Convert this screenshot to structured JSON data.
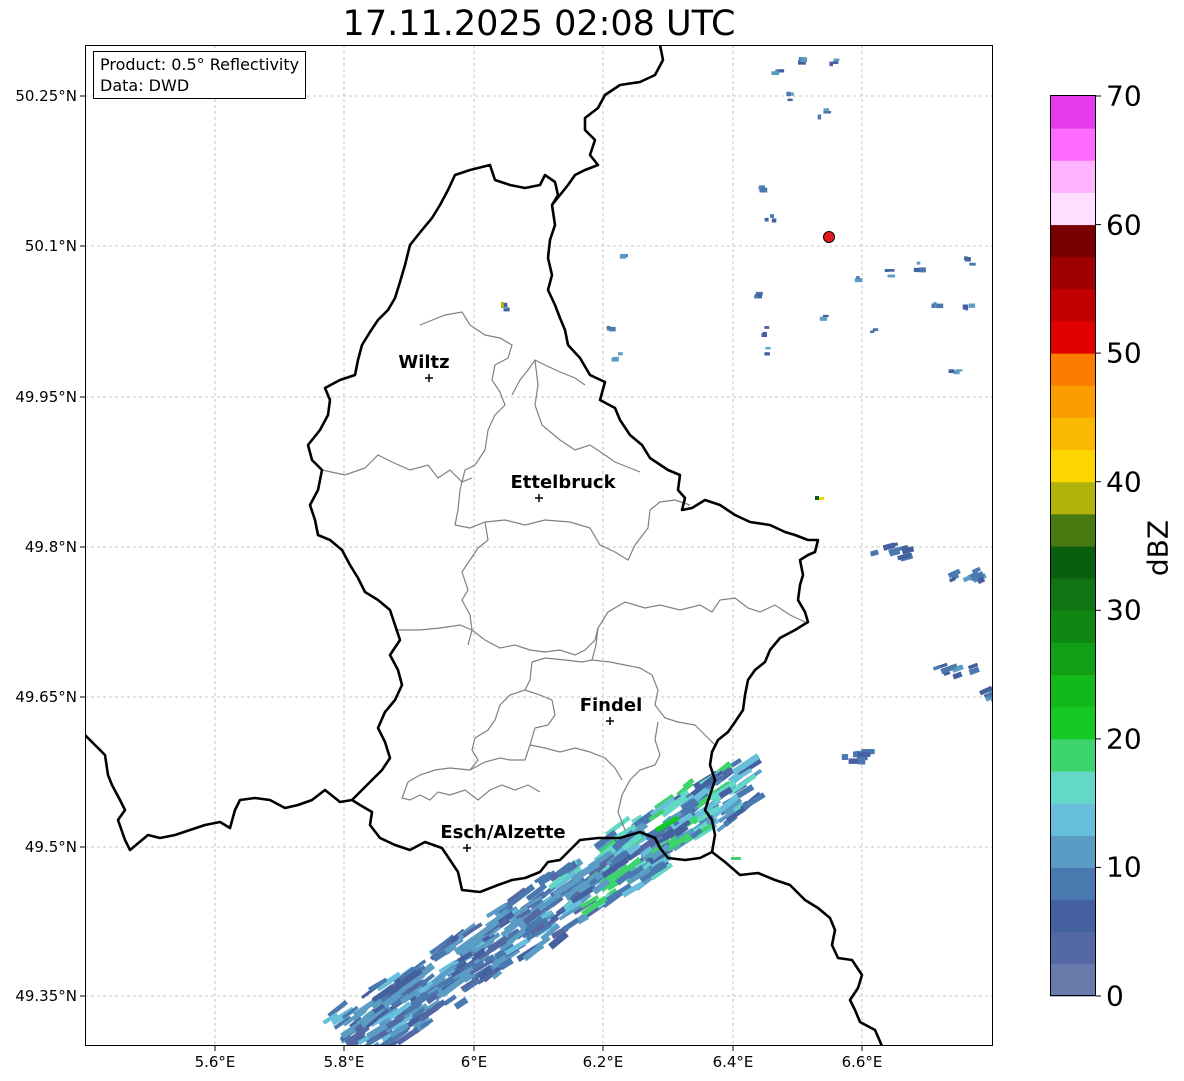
{
  "title": "17.11.2025 02:08 UTC",
  "info": {
    "product": "Product: 0.5° Reflectivity",
    "data": "Data: DWD"
  },
  "axes": {
    "lat_labels": [
      "50.25°N",
      "50.1°N",
      "49.95°N",
      "49.8°N",
      "49.65°N",
      "49.5°N",
      "49.35°N"
    ],
    "lon_labels": [
      "5.6°E",
      "5.8°E",
      "6°E",
      "6.2°E",
      "6.4°E",
      "6.6°E"
    ],
    "grid": true
  },
  "cities": [
    {
      "name": "Wiltz"
    },
    {
      "name": "Ettelbruck"
    },
    {
      "name": "Findel"
    },
    {
      "name": "Esch/Alzette"
    }
  ],
  "radar_site": {
    "marker_color": "#e31a1c"
  },
  "colorbar": {
    "label": "dBZ",
    "ticks": [
      "0",
      "10",
      "20",
      "30",
      "40",
      "50",
      "60",
      "70"
    ],
    "min": 0,
    "max": 70,
    "step": 2.5,
    "colors": [
      "#6a7bab",
      "#5469a3",
      "#44609f",
      "#4a79b0",
      "#5a9cc4",
      "#67bfdb",
      "#64d8c6",
      "#3ed46c",
      "#13c922",
      "#13b81a",
      "#119f15",
      "#0f8813",
      "#0e7512",
      "#0a5f0e",
      "#467a10",
      "#b0b30a",
      "#fbd600",
      "#fbb800",
      "#fb9c00",
      "#fb7c00",
      "#e10000",
      "#c20000",
      "#a00000",
      "#7a0000",
      "#ffdfff",
      "#ffb2ff",
      "#ff6aff",
      "#e63bee"
    ]
  }
}
